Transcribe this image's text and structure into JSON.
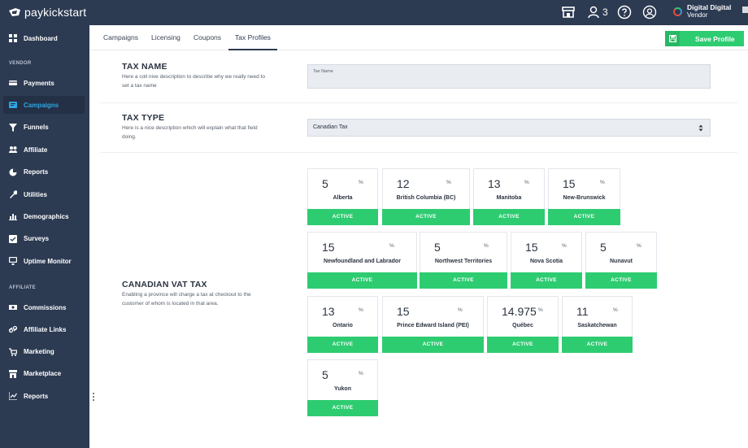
{
  "brand": {
    "name": "paykickstart",
    "accent": "#2ecc71",
    "nav_bg": "#2c3a52"
  },
  "topbar": {
    "store_icon": "store-icon",
    "users_count": "3",
    "help_icon": "question-circle-icon",
    "support_icon": "headset-icon",
    "account_name": "Digital Digital",
    "account_role": "Vendor"
  },
  "sidebar": {
    "top_items": [
      {
        "label": "Dashboard",
        "icon": "dashboard-icon"
      }
    ],
    "vendor_heading": "VENDOR",
    "vendor_items": [
      {
        "label": "Payments",
        "icon": "payments-icon"
      },
      {
        "label": "Campaigns",
        "icon": "campaigns-icon",
        "active": true
      },
      {
        "label": "Funnels",
        "icon": "funnel-icon"
      },
      {
        "label": "Affiliate",
        "icon": "users-icon"
      },
      {
        "label": "Reports",
        "icon": "pie-chart-icon"
      },
      {
        "label": "Utilities",
        "icon": "wrench-icon"
      },
      {
        "label": "Demographics",
        "icon": "bar-chart-icon"
      },
      {
        "label": "Surveys",
        "icon": "survey-icon"
      },
      {
        "label": "Uptime Monitor",
        "icon": "monitor-icon"
      }
    ],
    "affiliate_heading": "AFFILIATE",
    "affiliate_items": [
      {
        "label": "Commissions",
        "icon": "money-icon"
      },
      {
        "label": "Affiliate Links",
        "icon": "link-icon"
      },
      {
        "label": "Marketing",
        "icon": "cart-icon"
      },
      {
        "label": "Marketplace",
        "icon": "store-icon"
      },
      {
        "label": "Reports",
        "icon": "line-chart-icon"
      }
    ]
  },
  "tabs": [
    {
      "label": "Campaigns"
    },
    {
      "label": "Licensing"
    },
    {
      "label": "Coupons"
    },
    {
      "label": "Tax Profiles",
      "active": true
    }
  ],
  "save_button": {
    "label": "Save Profile"
  },
  "tax_name": {
    "title": "TAX NAME",
    "desc_line1": "Here a coll nive description to describe why we really need to",
    "desc_line2": "set a tax name",
    "placeholder": "Tax Name"
  },
  "tax_type": {
    "title": "TAX TYPE",
    "desc_line1": "Here is a nice description which will explain what that field",
    "desc_line2": "doing.",
    "selected": "Canadian Tax"
  },
  "vat": {
    "title": "CANADIAN VAT TAX",
    "desc_line1": "Enabling a province will charge a tax at checkout to the",
    "desc_line2": "customer of whom is located in that area."
  },
  "percent_symbol": "%",
  "provinces": [
    {
      "rate": "5",
      "name": "Alberta",
      "status": "ACTIVE"
    },
    {
      "rate": "12",
      "name": "British Columbia (BC)",
      "status": "ACTIVE"
    },
    {
      "rate": "13",
      "name": "Manitoba",
      "status": "ACTIVE"
    },
    {
      "rate": "15",
      "name": "New-Brunswick",
      "status": "ACTIVE"
    },
    {
      "rate": "15",
      "name": "Newfoundland and Labrador",
      "status": "ACTIVE"
    },
    {
      "rate": "5",
      "name": "Northwest Territories",
      "status": "ACTIVE"
    },
    {
      "rate": "15",
      "name": "Nova Scotia",
      "status": "ACTIVE"
    },
    {
      "rate": "5",
      "name": "Nunavut",
      "status": "ACTIVE"
    },
    {
      "rate": "13",
      "name": "Ontario",
      "status": "ACTIVE"
    },
    {
      "rate": "15",
      "name": "Prince Edward Island (PEI)",
      "status": "ACTIVE"
    },
    {
      "rate": "14.975",
      "name": "Québec",
      "status": "ACTIVE"
    },
    {
      "rate": "11",
      "name": "Saskatchewan",
      "status": "ACTIVE"
    },
    {
      "rate": "5",
      "name": "Yukon",
      "status": "ACTIVE"
    }
  ]
}
